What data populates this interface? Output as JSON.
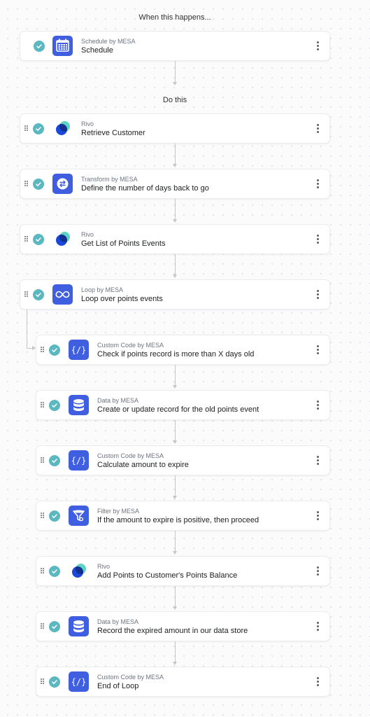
{
  "labels": {
    "trigger": "When this happens...",
    "actions": "Do this"
  },
  "colors": {
    "accent": "#3f5fe0",
    "check": "#5bb8c0",
    "rivo_teal": "#5ed3c4",
    "rivo_blue": "#1d47d8"
  },
  "trigger": {
    "app": "Schedule by MESA",
    "title": "Schedule",
    "icon": "calendar-icon"
  },
  "steps": [
    {
      "app": "Rivo",
      "title": "Retrieve Customer",
      "icon": "rivo-logo-icon"
    },
    {
      "app": "Transform by MESA",
      "title": "Define the number of days back to go",
      "icon": "transform-arrows-icon"
    },
    {
      "app": "Rivo",
      "title": "Get List of Points Events",
      "icon": "rivo-logo-icon"
    },
    {
      "app": "Loop by MESA",
      "title": "Loop over points events",
      "icon": "infinity-icon"
    }
  ],
  "loop_steps": [
    {
      "app": "Custom Code by MESA",
      "title": "Check if points record is more than X days old",
      "icon": "code-braces-icon"
    },
    {
      "app": "Data by MESA",
      "title": "Create or update record for the old points event",
      "icon": "database-icon"
    },
    {
      "app": "Custom Code by MESA",
      "title": "Calculate amount to expire",
      "icon": "code-braces-icon"
    },
    {
      "app": "Filter by MESA",
      "title": "If the amount to expire is positive, then proceed",
      "icon": "funnel-icon"
    },
    {
      "app": "Rivo",
      "title": "Add Points to Customer's Points Balance",
      "icon": "rivo-logo-icon"
    },
    {
      "app": "Data by MESA",
      "title": "Record the expired amount in our data store",
      "icon": "database-icon"
    },
    {
      "app": "Custom Code by MESA",
      "title": "End of Loop",
      "icon": "code-braces-icon"
    }
  ]
}
